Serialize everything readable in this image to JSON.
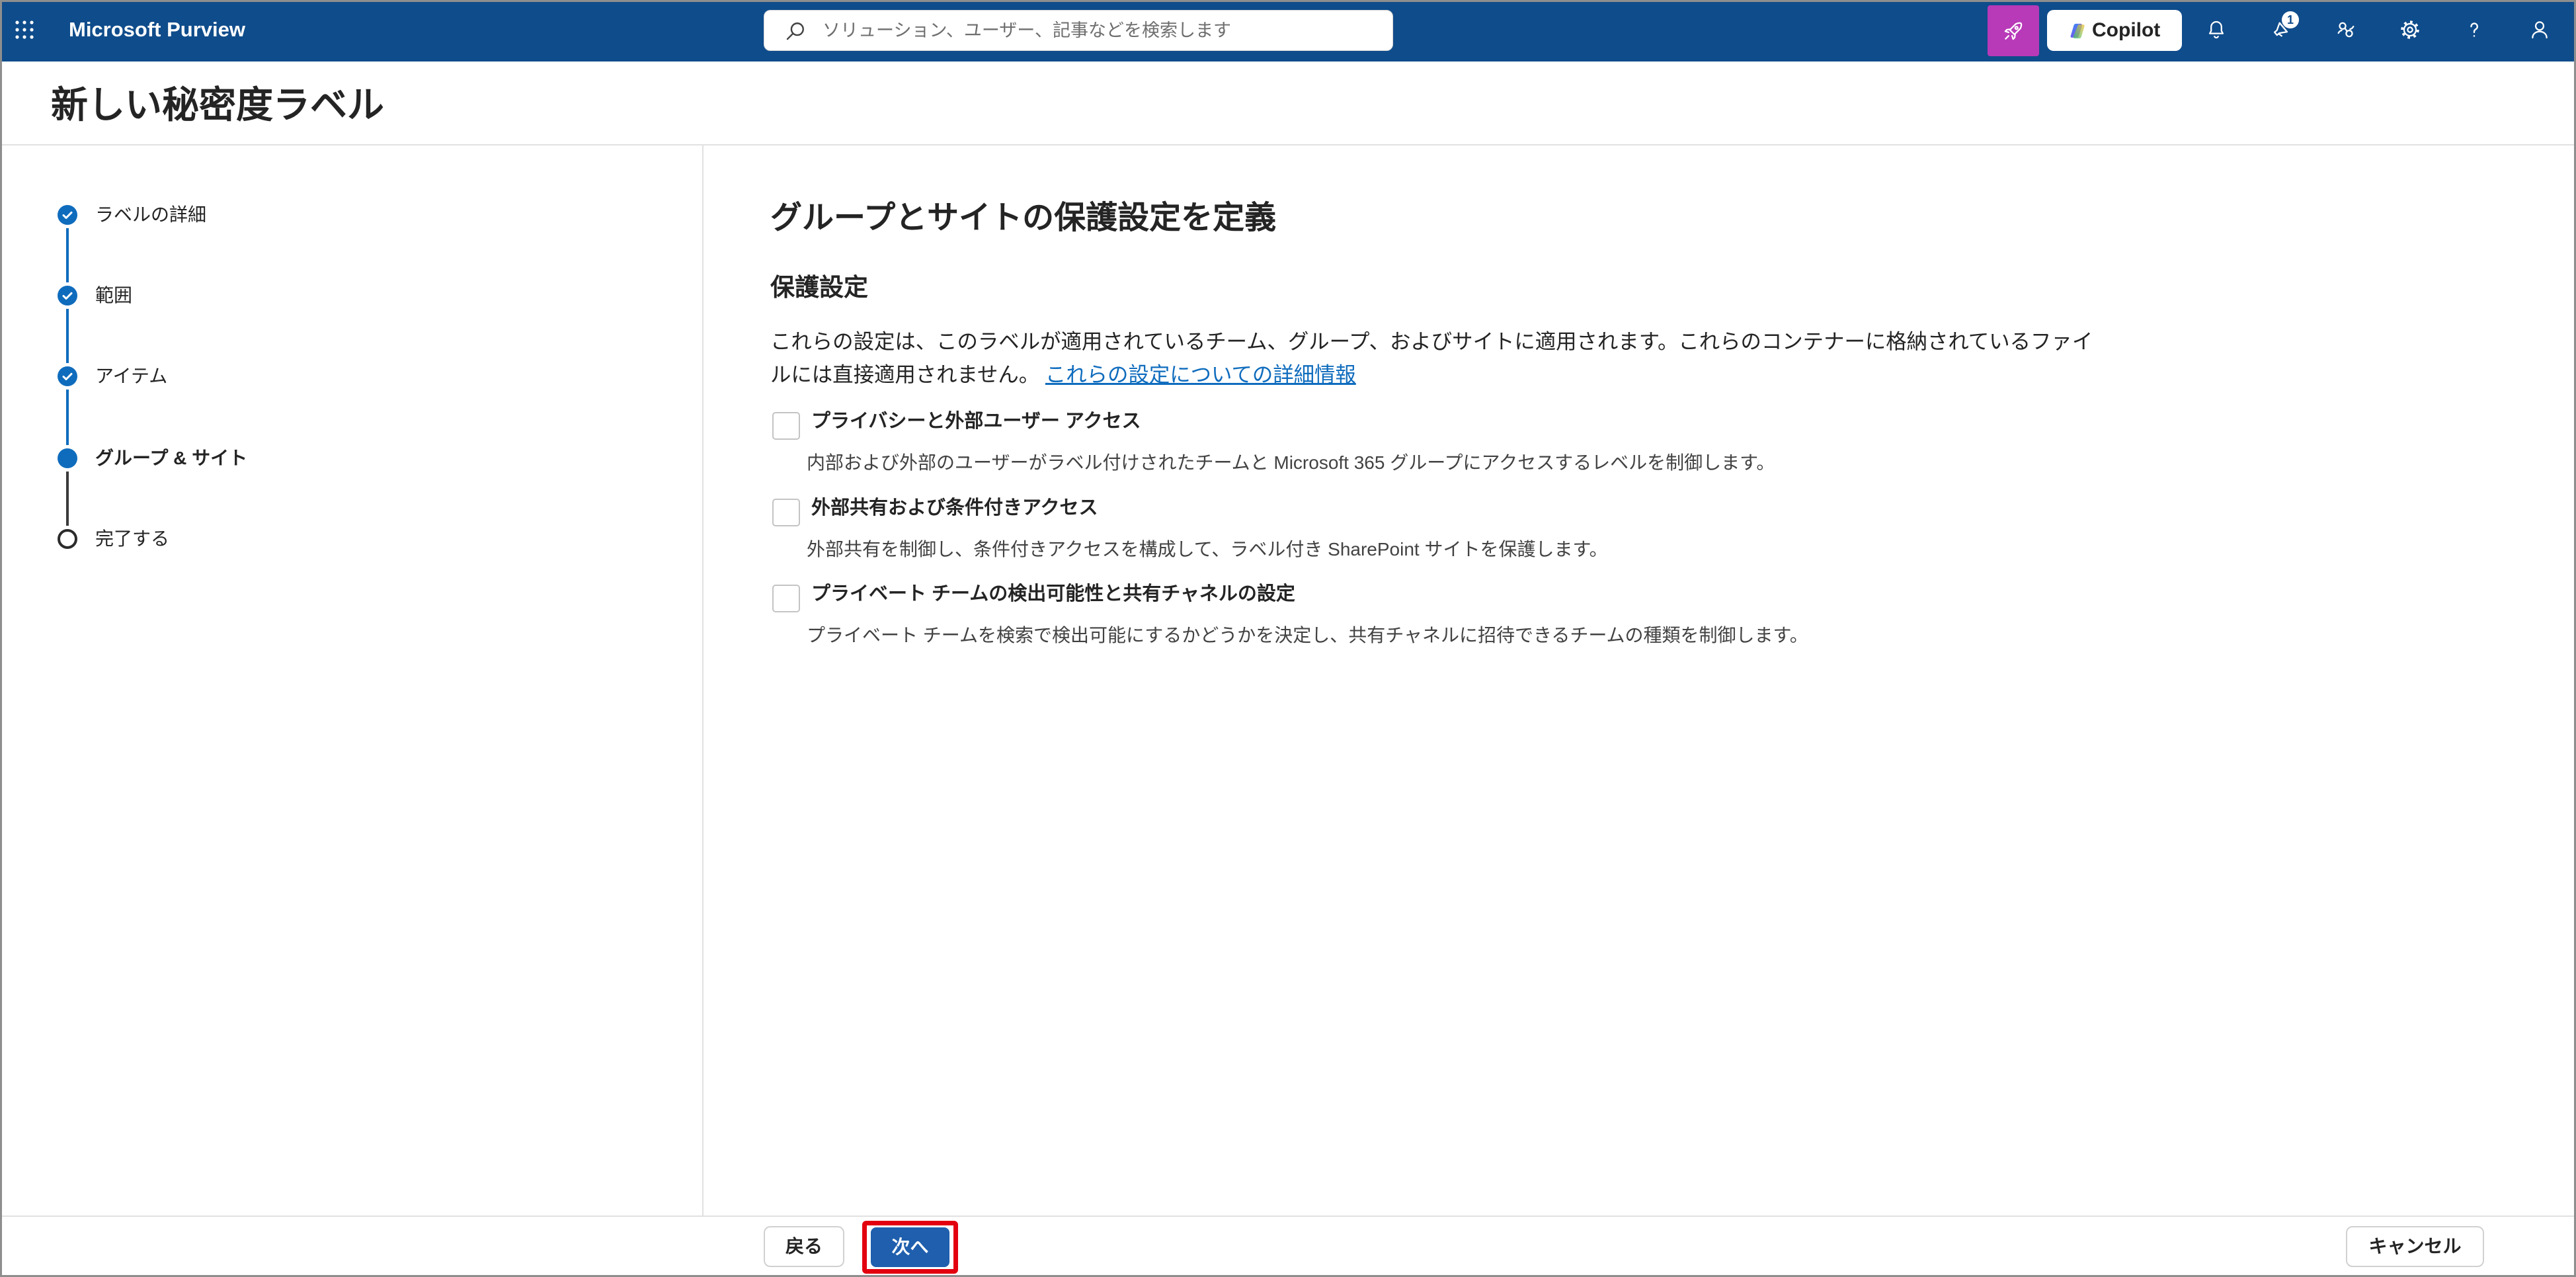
{
  "app": {
    "title": "Microsoft Purview"
  },
  "search": {
    "placeholder": "ソリューション、ユーザー、記事などを検索します"
  },
  "header": {
    "copilot_label": "Copilot",
    "notification_badge": "1",
    "icons": [
      "waffle-icon",
      "search-icon",
      "rocket-icon",
      "copilot-icon",
      "bell-icon",
      "announcement-icon",
      "connections-icon",
      "gear-icon",
      "help-icon",
      "person-icon"
    ]
  },
  "page": {
    "title": "新しい秘密度ラベル"
  },
  "wizard_steps": [
    {
      "label": "ラベルの詳細",
      "completed": true,
      "current": false
    },
    {
      "label": "範囲",
      "completed": true,
      "current": false
    },
    {
      "label": "アイテム",
      "completed": true,
      "current": false
    },
    {
      "label": "グループ & サイト",
      "completed": false,
      "current": true
    },
    {
      "label": "完了する",
      "completed": false,
      "current": false
    }
  ],
  "main": {
    "heading": "グループとサイトの保護設定を定義",
    "section_title": "保護設定",
    "description": "これらの設定は、このラベルが適用されているチーム、グループ、およびサイトに適用されます。これらのコンテナーに格納されているファイルには直接適用されません。",
    "learn_more_link": "これらの設定についての詳細情報",
    "options": [
      {
        "label": "プライバシーと外部ユーザー アクセス",
        "description": "内部および外部のユーザーがラベル付けされたチームと Microsoft 365 グループにアクセスするレベルを制御します。",
        "checked": false
      },
      {
        "label": "外部共有および条件付きアクセス",
        "description": "外部共有を制御し、条件付きアクセスを構成して、ラベル付き SharePoint サイトを保護します。",
        "checked": false
      },
      {
        "label": "プライベート チームの検出可能性と共有チャネルの設定",
        "description": "プライベート チームを検索で検出可能にするかどうかを決定し、共有チャネルに招待できるチームの種類を制御します。",
        "checked": false
      }
    ]
  },
  "footer": {
    "back_label": "戻る",
    "next_label": "次へ",
    "cancel_label": "キャンセル"
  },
  "colors": {
    "header_background": "#0f4c8b",
    "brand_blue": "#0f6cbd",
    "primary_button": "#1f5fae",
    "purview_apps_button": "#b83ab8",
    "highlight_border": "#e3000f",
    "link": "#0f6cbd"
  }
}
